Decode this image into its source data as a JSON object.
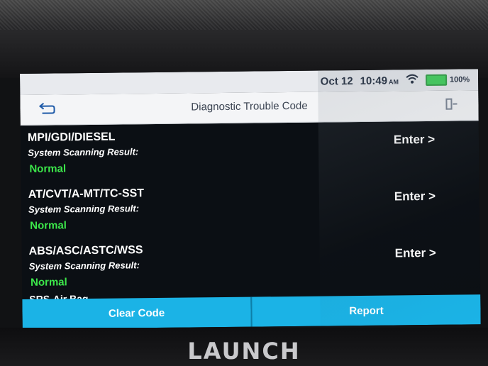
{
  "device": {
    "brand": "LAUNCH"
  },
  "status_bar": {
    "date": "Oct 12",
    "time": "10:49",
    "ampm": "AM",
    "battery": "100%",
    "icons": [
      "wifi-icon",
      "battery-icon"
    ]
  },
  "header": {
    "title": "Diagnostic Trouble Code",
    "back_icon": "back-arrow-icon",
    "exit_icon": "exit-door-icon"
  },
  "systems": [
    {
      "name": "MPI/GDI/DIESEL",
      "scan_label": "System Scanning Result:",
      "result": "Normal",
      "enter_label": "Enter >"
    },
    {
      "name": "AT/CVT/A-MT/TC-SST",
      "scan_label": "System Scanning Result:",
      "result": "Normal",
      "enter_label": "Enter >"
    },
    {
      "name": "ABS/ASC/ASTC/WSS",
      "scan_label": "System Scanning Result:",
      "result": "Normal",
      "enter_label": "Enter >"
    }
  ],
  "partial_system": "SRS-Air Bag",
  "actions": {
    "clear_code": "Clear Code",
    "report": "Report"
  },
  "colors": {
    "accent": "#1bb3e6",
    "normal": "#3ce64a",
    "screen_bg": "#0b0f14"
  }
}
